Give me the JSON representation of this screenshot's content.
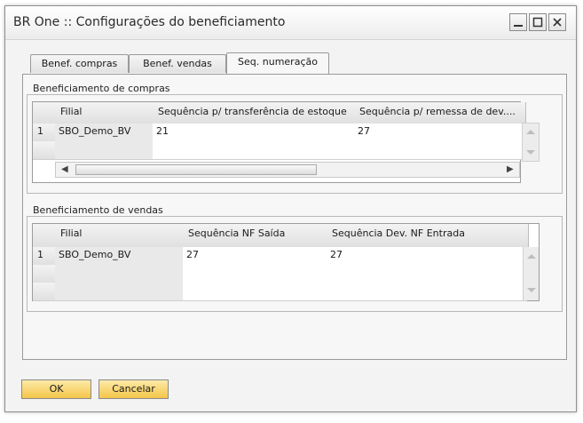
{
  "window": {
    "title": "BR One :: Configurações do beneficiamento"
  },
  "tabs": [
    {
      "label": "Benef. compras"
    },
    {
      "label": "Benef. vendas"
    },
    {
      "label": "Seq. numeração"
    }
  ],
  "compras": {
    "label": "Beneficiamento de compras",
    "headers": [
      "Filial",
      "Sequência p/ transferência de estoque",
      "Sequência p/ remessa de dev...."
    ],
    "rows": [
      {
        "num": "1",
        "filial": "SBO_Demo_BV",
        "seq1": "21",
        "seq2": "27"
      }
    ]
  },
  "vendas": {
    "label": "Beneficiamento de vendas",
    "headers": [
      "Filial",
      "Sequência NF Saída",
      "Sequência Dev. NF Entrada"
    ],
    "rows": [
      {
        "num": "1",
        "filial": "SBO_Demo_BV",
        "seq1": "27",
        "seq2": "27"
      }
    ]
  },
  "buttons": {
    "ok": "OK",
    "cancel": "Cancelar"
  },
  "icons": {
    "minimize": "minimize-icon",
    "maximize": "maximize-icon",
    "close": "close-icon"
  }
}
